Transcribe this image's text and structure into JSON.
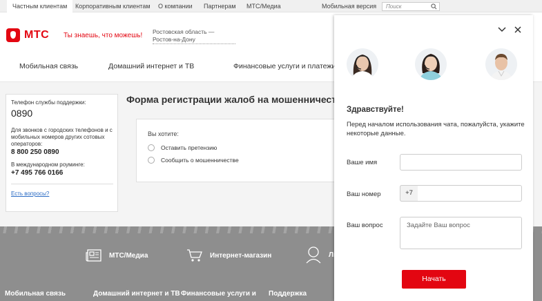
{
  "topbar": {
    "tabs": [
      "Частным клиентам",
      "Корпоративным клиентам",
      "О компании",
      "Партнерам",
      "МТС/Медиа"
    ],
    "mobile": "Мобильная версия",
    "search_placeholder": "Поиск"
  },
  "header": {
    "logo": "МТС",
    "slogan": "Ты знаешь, что можешь!",
    "region": "Ростовская область — Ростов-на-Дону"
  },
  "nav": [
    "Мобильная связь",
    "Домашний интернет и ТВ",
    "Финансовые услуги и платежи"
  ],
  "support": {
    "phone_label": "Телефон службы поддержки:",
    "phone": "0890",
    "city_label": "Для звонков с городских телефонов и с мобильных номеров других сотовых операторов:",
    "city_phone": "8 800 250 0890",
    "roaming_label": "В международном роуминге:",
    "roaming_phone": "+7 495 766 0166",
    "questions": "Есть вопросы?"
  },
  "form": {
    "title": "Форма регистрации жалоб на мошенничество",
    "question": "Вы хотите:",
    "options": [
      "Оставить претензию",
      "Сообщить о мошенничестве"
    ]
  },
  "footer": {
    "icons": [
      "МТС/Медиа",
      "Интернет-магазин",
      "Ли"
    ],
    "links": [
      "Мобильная связь",
      "Домашний интернет и ТВ",
      "Финансовые услуги и",
      "Поддержка"
    ]
  },
  "chat": {
    "greeting": "Здравствуйте!",
    "intro": "Перед началом использования чата, пожалуйста, укажите некоторые данные.",
    "name_label": "Ваше имя",
    "phone_label": "Ваш номер",
    "phone_prefix": "+7",
    "question_label": "Ваш вопрос",
    "question_placeholder": "Задайте Ваш вопрос",
    "start": "Начать"
  },
  "colors": {
    "brand": "#e30611",
    "footer": "#8e8e8e"
  }
}
